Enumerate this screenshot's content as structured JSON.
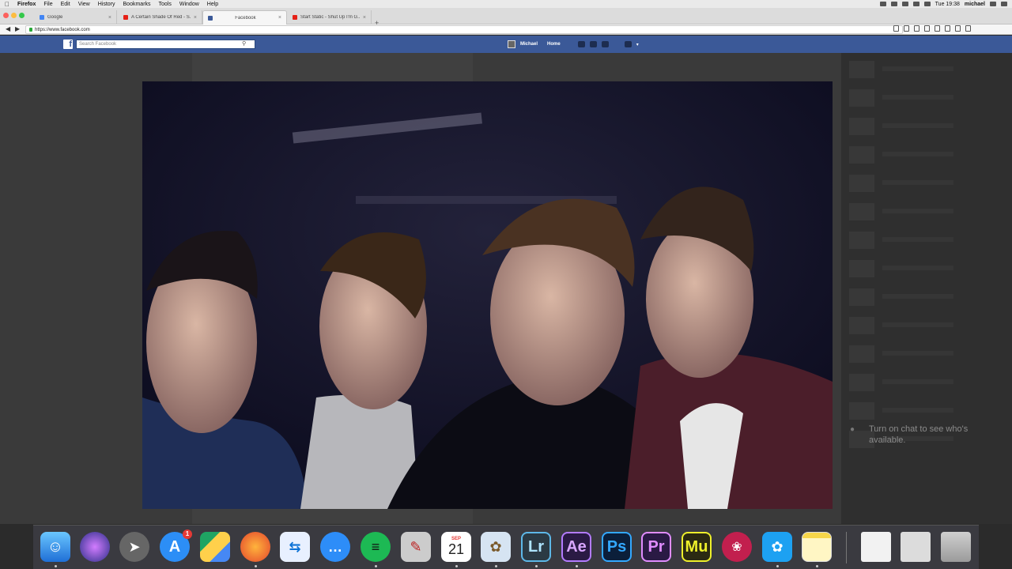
{
  "menubar": {
    "app": "Firefox",
    "menus": [
      "File",
      "Edit",
      "View",
      "History",
      "Bookmarks",
      "Tools",
      "Window",
      "Help"
    ],
    "clock": "Tue 19:38",
    "user": "michael"
  },
  "tabs": [
    {
      "title": "Google",
      "color": "#4285f4"
    },
    {
      "title": "A Certain Shade Of Red - S...",
      "color": "#e62117"
    },
    {
      "title": "Facebook",
      "color": "#3b5998"
    },
    {
      "title": "Start Static - Shut Up I'm G...",
      "color": "#e62117"
    }
  ],
  "url": "https://www.facebook.com",
  "facebook": {
    "logo": "f",
    "search_placeholder": "Search Facebook",
    "profile_name": "Michael",
    "home_label": "Home"
  },
  "sidebar": {
    "chat_note": "Turn on chat to see who's available."
  },
  "dock": {
    "apps": [
      {
        "name": "Finder",
        "icon": "finder-icon"
      },
      {
        "name": "Siri",
        "icon": "siri-icon"
      },
      {
        "name": "Launchpad",
        "icon": "launchpad-icon"
      },
      {
        "name": "App Store",
        "icon": "app-store-icon",
        "badge": "1"
      },
      {
        "name": "Google Drive",
        "icon": "google-drive-icon"
      },
      {
        "name": "Firefox",
        "icon": "firefox-icon"
      },
      {
        "name": "TeamViewer",
        "icon": "teamviewer-icon"
      },
      {
        "name": "Messages",
        "icon": "messages-icon"
      },
      {
        "name": "Spotify",
        "icon": "spotify-icon"
      },
      {
        "name": "Script Editor",
        "icon": "script-icon"
      },
      {
        "name": "Calendar",
        "icon": "calendar-icon",
        "month": "SEP",
        "day": "21"
      },
      {
        "name": "Preview",
        "icon": "preview-icon"
      },
      {
        "name": "Lightroom",
        "icon": "lightroom-icon",
        "label": "Lr"
      },
      {
        "name": "After Effects",
        "icon": "after-effects-icon",
        "label": "Ae"
      },
      {
        "name": "Photoshop",
        "icon": "photoshop-icon",
        "label": "Ps"
      },
      {
        "name": "Premiere",
        "icon": "premiere-icon",
        "label": "Pr"
      },
      {
        "name": "Muse",
        "icon": "muse-icon",
        "label": "Mu"
      },
      {
        "name": "DaVinci Resolve",
        "icon": "davinci-icon"
      },
      {
        "name": "Twitter",
        "icon": "twitter-icon"
      },
      {
        "name": "Notes",
        "icon": "notes-icon"
      },
      {
        "name": "Document",
        "icon": "document-icon"
      },
      {
        "name": "Downloads",
        "icon": "downloads-icon"
      },
      {
        "name": "Trash",
        "icon": "trash-icon"
      }
    ]
  }
}
